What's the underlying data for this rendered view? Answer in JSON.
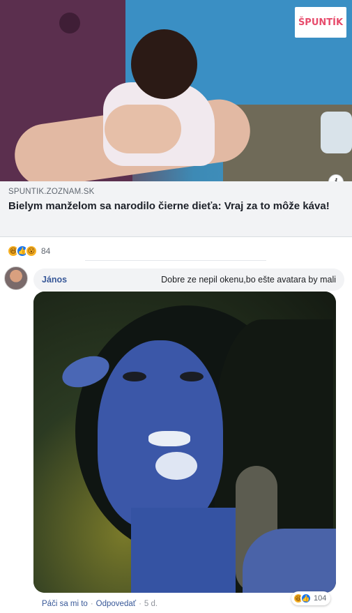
{
  "link_preview": {
    "brand_badge": "ŠPUNTÍK",
    "info_icon": "i",
    "domain": "SPUNTIK.ZOZNAM.SK",
    "title": "Bielym manželom sa narodilo čierne dieťa: Vraj za to môže káva!"
  },
  "post_reactions": {
    "icons": [
      "haha-icon",
      "like-icon",
      "wow-icon"
    ],
    "count": "84"
  },
  "comment": {
    "author": "János",
    "text": "Dobre ze nepil okenu,bo ešte avatara by mali",
    "actions": {
      "like": "Páči sa mi to",
      "reply": "Odpovedať",
      "separator": "·",
      "time": "5 d."
    },
    "reactions": {
      "icons": [
        "haha-icon",
        "like-icon"
      ],
      "count": "104"
    }
  },
  "colors": {
    "link_blue": "#385898",
    "like_blue": "#1877f2",
    "emoji_yellow": "#f7b125",
    "caption_bg": "#f2f3f5",
    "brand_pink": "#e74c6c"
  }
}
